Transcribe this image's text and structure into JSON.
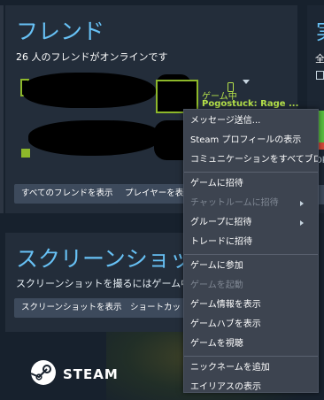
{
  "friends": {
    "title": "フレンド",
    "online_text": "26 人のフレンドがオンラインです",
    "show_all_button": "すべてのフレンドを表示",
    "show_players_button": "プレイヤーを表示",
    "ingame_status": "ゲーム中",
    "ingame_game": "Pogostuck: Rage ..."
  },
  "screenshots": {
    "title": "スクリーンショット",
    "description": "スクリーンショットを撮るにはゲーム中に F12 を",
    "show_screenshots_button": "スクリーンショットを表示",
    "shortcut_button": "ショートカットを設"
  },
  "right_panel": {
    "title": "実",
    "subtitle": "全",
    "bottom_fragment": "Ok"
  },
  "steam_logo_text": "STEAM",
  "context_menu": {
    "groups": [
      [
        {
          "label": "メッセージ送信...",
          "disabled": false,
          "submenu": false
        },
        {
          "label": "Steam プロフィールの表示",
          "disabled": false,
          "submenu": false
        },
        {
          "label": "コミュニケーションをすべてブロッ...",
          "disabled": false,
          "submenu": false
        }
      ],
      [
        {
          "label": "ゲームに招待",
          "disabled": false,
          "submenu": false
        },
        {
          "label": "チャットルームに招待",
          "disabled": true,
          "submenu": true
        },
        {
          "label": "グループに招待",
          "disabled": false,
          "submenu": true
        },
        {
          "label": "トレードに招待",
          "disabled": false,
          "submenu": false
        }
      ],
      [
        {
          "label": "ゲームに参加",
          "disabled": false,
          "submenu": false
        },
        {
          "label": "ゲームを起動",
          "disabled": true,
          "submenu": false
        },
        {
          "label": "ゲーム情報を表示",
          "disabled": false,
          "submenu": false
        },
        {
          "label": "ゲームハブを表示",
          "disabled": false,
          "submenu": false
        },
        {
          "label": "ゲームを視聴",
          "disabled": false,
          "submenu": false
        }
      ],
      [
        {
          "label": "ニックネームを追加",
          "disabled": false,
          "submenu": false
        },
        {
          "label": "エイリアスの表示",
          "disabled": false,
          "submenu": false
        }
      ]
    ]
  },
  "colors": {
    "accent_blue": "#67c1f5",
    "ingame_green": "#b6e24a",
    "panel_bg": "#232d3a",
    "menu_bg": "#3d4450"
  },
  "icons": {
    "mobile": "mobile-phone-icon",
    "caret": "chevron-down-icon",
    "steam": "steam-logo-icon",
    "submenu": "chevron-right-icon"
  }
}
